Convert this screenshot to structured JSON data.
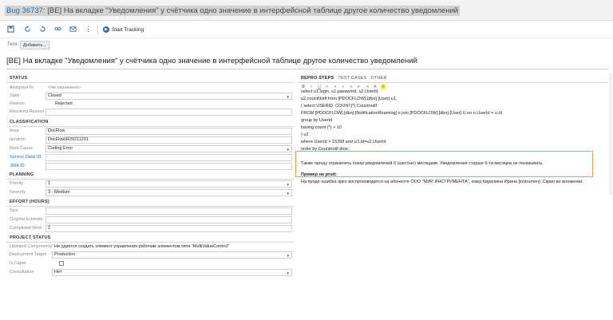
{
  "window": {
    "bug_id": "Bug 36737:",
    "title_rest": " [BE] На вкладке \"Уведомления\" у счётчика одно значение в интерфейсной таблице другое количество уведомлений"
  },
  "toolbar": {
    "start_tracking_label": "Start Tracking"
  },
  "tags": {
    "label": "Теги",
    "add_button": "Добавить..."
  },
  "work_item_title": "[BE] На вкладке \"Уведомления\" у счётчика одно значение в интерфейсной таблице другое количество уведомлений",
  "status": {
    "section": "STATUS",
    "assigned_to": {
      "label": "Assigned To",
      "value": "<Не назначено>"
    },
    "state": {
      "label": "State",
      "value": "Closed"
    },
    "reason": {
      "label": "Reason",
      "value": "Rejected"
    },
    "resolved_reason": {
      "label": "Resolved Reason",
      "value": ""
    }
  },
  "classification": {
    "section": "CLASSIFICATION",
    "area": {
      "label": "Area",
      "value": "DocFlow"
    },
    "iteration": {
      "label": "Iteration",
      "value": "DocFlow\\R20211201"
    },
    "root_cause": {
      "label": "Root Cause",
      "value": "Coding Error"
    },
    "service_desk_id": {
      "label": "Service Desk ID:",
      "value": ""
    },
    "jira_id": {
      "label": "JIRA ID:",
      "value": ""
    }
  },
  "planning": {
    "section": "PLANNING",
    "priority": {
      "label": "Priority",
      "value": "1"
    },
    "severity": {
      "label": "Severity",
      "value": "3 - Medium"
    }
  },
  "effort": {
    "section": "EFFORT (HOURS)",
    "size": {
      "label": "Size",
      "value": ""
    },
    "original_estimate": {
      "label": "Original Estimate",
      "value": ""
    },
    "completed_work": {
      "label": "Completed Work",
      "value": "2"
    }
  },
  "project_status": {
    "section": "PROJECT STATUS",
    "updated_components": {
      "label": "Updated Components",
      "value": "Не удается создать элемент управления рабочим элементом типа \"MultiValueControl\""
    },
    "deployment_target": {
      "label": "Deployment Target",
      "value": "Production"
    },
    "is_caper": {
      "label": "Is Caper",
      "value": ""
    },
    "consultation": {
      "label": "Consultation",
      "value": "Нет"
    }
  },
  "tabs": {
    "repro": "REPRO STEPS",
    "test_cases": "TEST CASES",
    "other": "OTHER"
  },
  "formatting": [
    "B",
    "I",
    "U",
    "≡",
    "≡",
    "≡",
    "≡",
    "⇤",
    "⇥",
    "A",
    "A"
  ],
  "repro_steps": {
    "lines": [
      "select u1.login, u1.password, u2.UserId,",
      "u2.countNotif from [PDOCFLOW].[dbo].[User] u1,",
      "( select USERID, COUNT(*) Countnotif",
      "FROM [PDOCFLOW].[dbo].[NotificationRoaming] n join [PDOCFLOW].[dbo].[User] U on n.UserId = u.Id",
      "group by UserId",
      "having count (*) > 10",
      ") u2",
      "where UserId = 15398 and U1.id=u2.UserId",
      "order by Countnotif desc"
    ],
    "highlight_text": "Также прошу ограничить показ уведомлений 6 (шестью) месяцами. Уведомления старше 6-ти месяцев не показывать.",
    "example_heading": "Пример на prod:",
    "example_text": "На проде ошибка ярко воспроизводится на абоненте ООО \"МИР ИНСТРУМЕНТА\", юзер Кирюхина Ирина [instrumen]. Скрин во вложении."
  }
}
